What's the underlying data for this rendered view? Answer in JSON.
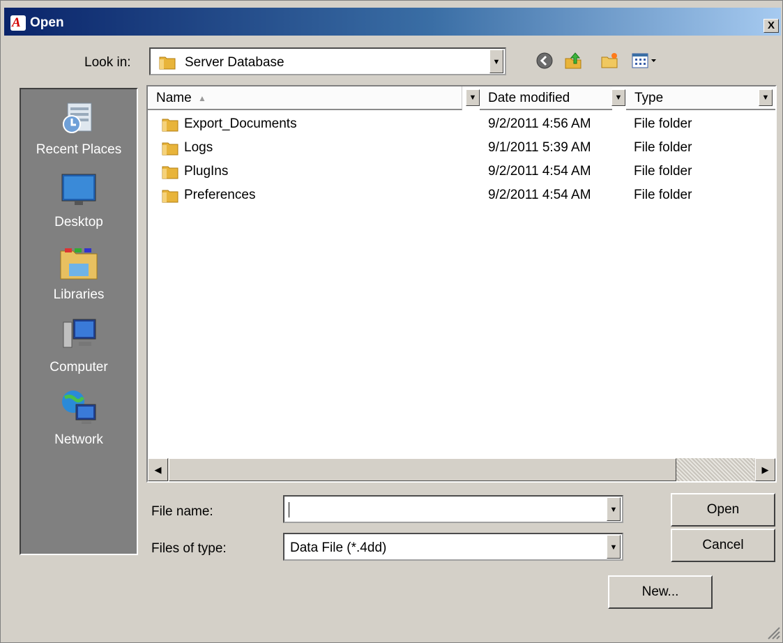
{
  "window": {
    "title": "Open",
    "app_logo": "A",
    "close_label": "X"
  },
  "lookin": {
    "label": "Look in:",
    "value": "Server Database"
  },
  "toolbar": {
    "icons": [
      "back-icon",
      "up-folder-icon",
      "new-folder-icon",
      "views-menu-icon"
    ]
  },
  "places": [
    {
      "label": "Recent Places",
      "icon": "recent-places-icon"
    },
    {
      "label": "Desktop",
      "icon": "desktop-icon"
    },
    {
      "label": "Libraries",
      "icon": "libraries-icon"
    },
    {
      "label": "Computer",
      "icon": "computer-icon"
    },
    {
      "label": "Network",
      "icon": "network-icon"
    }
  ],
  "files": {
    "columns": [
      {
        "label": "Name",
        "sort_indicator": "▲"
      },
      {
        "label": "Date modified"
      },
      {
        "label": "Type"
      }
    ],
    "rows": [
      {
        "name": "Export_Documents",
        "date": "9/2/2011 4:56 AM",
        "type": "File folder"
      },
      {
        "name": "Logs",
        "date": "9/1/2011 5:39 AM",
        "type": "File folder"
      },
      {
        "name": "PlugIns",
        "date": "9/2/2011 4:54 AM",
        "type": "File folder"
      },
      {
        "name": "Preferences",
        "date": "9/2/2011 4:54 AM",
        "type": "File folder"
      }
    ]
  },
  "form": {
    "filename_label": "File name:",
    "filename_value": "",
    "filetype_label": "Files of type:",
    "filetype_value": "Data File (*.4dd)"
  },
  "buttons": {
    "open": "Open",
    "cancel": "Cancel",
    "new": "New..."
  },
  "colors": {
    "title_start": "#0a246a",
    "title_end": "#a6caf0",
    "dialog_bg": "#d4d0c8",
    "places_bg": "#808080",
    "folder": "#e8b43a"
  }
}
